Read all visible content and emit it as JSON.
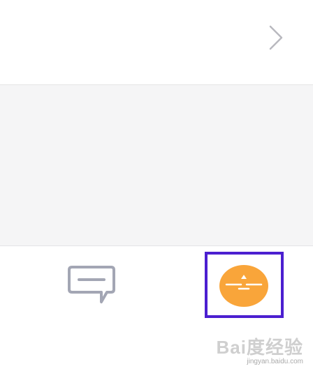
{
  "icons": {
    "chevron": "chevron-right-icon",
    "chat": "comment-icon",
    "action": "orange-circle-action-icon"
  },
  "colors": {
    "highlight": "#4b1fd0",
    "action_orange": "#f9a53a",
    "chat_gray": "#a3a6b4",
    "chevron_gray": "#b9b9bf",
    "panel_bg": "#f5f5f6"
  },
  "watermark": {
    "logo": "Bai度经验",
    "url": "jingyan.baidu.com"
  }
}
